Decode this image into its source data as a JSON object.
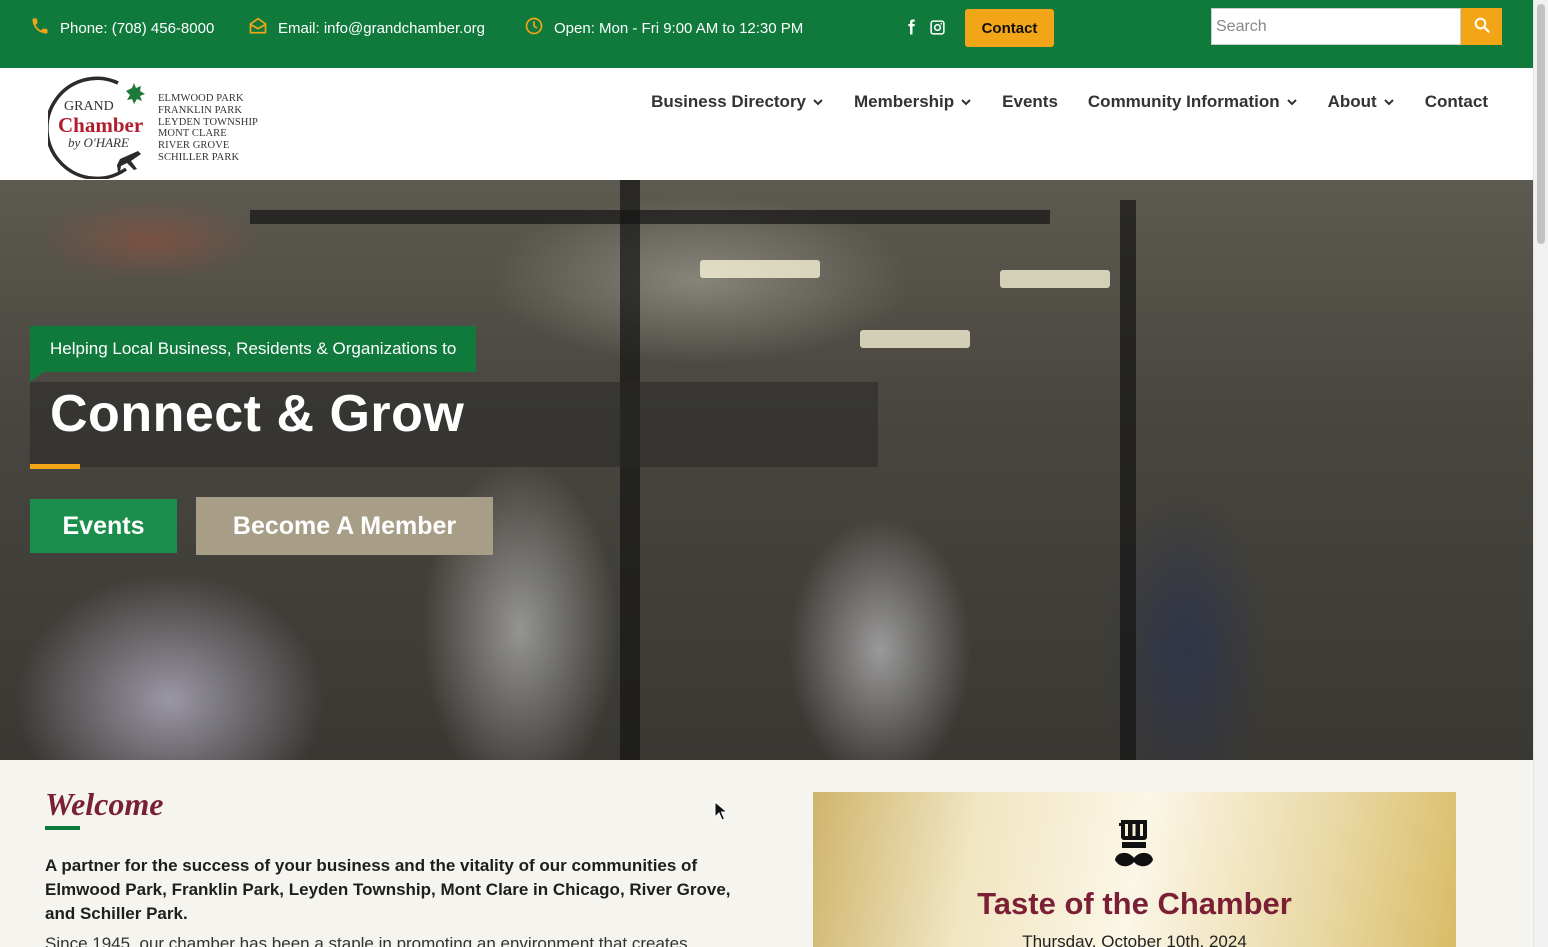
{
  "topbar": {
    "phone": "Phone: (708) 456-8000",
    "email": "Email: info@grandchamber.org",
    "hours": "Open: Mon - Fri 9:00 AM to 12:30 PM",
    "social": [
      "facebook-icon",
      "instagram-icon"
    ],
    "contact_label": "Contact",
    "search_placeholder": "Search",
    "colors": {
      "bar": "#0f7a3c",
      "accent": "#f2a516"
    }
  },
  "logo": {
    "line1": "GRAND",
    "line2": "Chamber",
    "line3": "by O'HARE",
    "towns": [
      "ELMWOOD PARK",
      "FRANKLIN PARK",
      "LEYDEN TOWNSHIP",
      "MONT CLARE",
      "RIVER GROVE",
      "SCHILLER PARK"
    ]
  },
  "nav": {
    "items": [
      {
        "label": "Business Directory",
        "dropdown": true
      },
      {
        "label": "Membership",
        "dropdown": true
      },
      {
        "label": "Events",
        "dropdown": false
      },
      {
        "label": "Community Information",
        "dropdown": true
      },
      {
        "label": "About",
        "dropdown": true
      },
      {
        "label": "Contact",
        "dropdown": false
      }
    ]
  },
  "hero": {
    "tagline": "Helping Local Business, Residents & Organizations to",
    "headline": "Connect & Grow",
    "events_button": "Events",
    "member_button": "Become A Member"
  },
  "welcome": {
    "title": "Welcome",
    "lead": "A partner for the success of your business and the vitality of our communities of Elmwood Park, Franklin Park, Leyden Township, Mont Clare in Chicago, River Grove, and Schiller Park.",
    "body": "Since 1945, our chamber has been a staple in promoting an environment that creates"
  },
  "event_card": {
    "icon": "chef-hat-icon",
    "title": "Taste of the Chamber",
    "date": "Thursday, October 10th, 2024"
  }
}
